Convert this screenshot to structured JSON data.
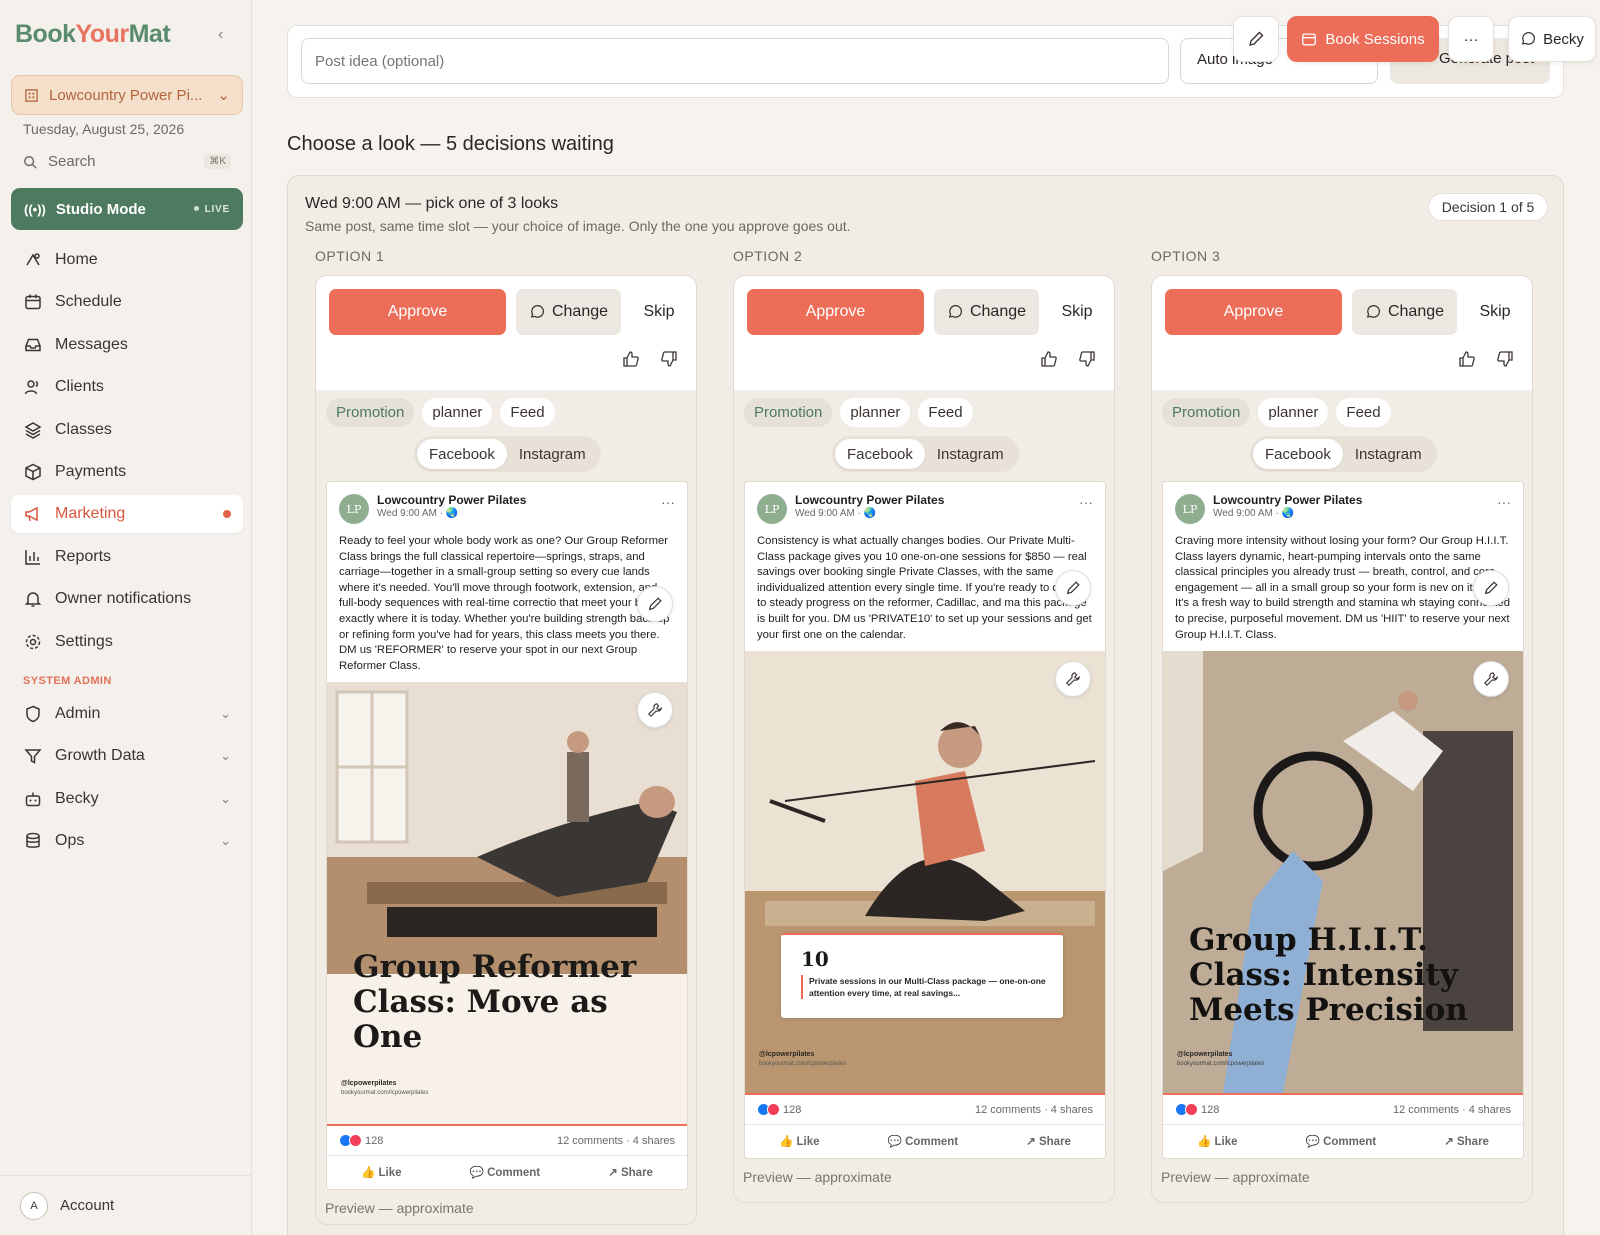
{
  "app": {
    "logo_part1": "Book",
    "logo_part2": "Your",
    "logo_part3": "Mat",
    "studio_name": "Lowcountry Power Pi...",
    "date": "Tuesday, August 25, 2026",
    "search_label": "Search",
    "search_shortcut": "⌘K",
    "studio_mode_label": "Studio Mode",
    "studio_mode_badge": "LIVE"
  },
  "nav": {
    "items": [
      {
        "label": "Home",
        "icon": "home-icon"
      },
      {
        "label": "Schedule",
        "icon": "calendar-icon"
      },
      {
        "label": "Messages",
        "icon": "inbox-icon"
      },
      {
        "label": "Clients",
        "icon": "users-icon"
      },
      {
        "label": "Classes",
        "icon": "layers-icon"
      },
      {
        "label": "Payments",
        "icon": "package-icon"
      },
      {
        "label": "Marketing",
        "icon": "megaphone-icon",
        "active": true
      },
      {
        "label": "Reports",
        "icon": "bar-chart-icon"
      },
      {
        "label": "Owner notifications",
        "icon": "bell-icon"
      },
      {
        "label": "Settings",
        "icon": "gear-icon"
      }
    ],
    "system_admin_heading": "SYSTEM ADMIN",
    "admin_items": [
      {
        "label": "Admin",
        "icon": "shield-icon"
      },
      {
        "label": "Growth Data",
        "icon": "filter-icon"
      },
      {
        "label": "Becky",
        "icon": "bot-icon"
      },
      {
        "label": "Ops",
        "icon": "database-icon"
      }
    ],
    "account_avatar": "A",
    "account_label": "Account"
  },
  "topbar": {
    "post_idea_placeholder": "Post idea (optional)",
    "auto_image": "Auto image",
    "generate_post": "Generate post",
    "book_sessions": "Book Sessions",
    "more": "···",
    "becky": "Becky"
  },
  "main": {
    "section_title": "Choose a look — 5 decisions waiting",
    "decision_title": "Wed 9:00 AM — pick one of 3 looks",
    "decision_subtitle": "Same post, same time slot — your choice of image. Only the one you approve goes out.",
    "decision_badge": "Decision 1 of 5"
  },
  "option_common": {
    "approve": "Approve",
    "change": "Change",
    "skip": "Skip",
    "chip_promotion": "Promotion",
    "chip_planner": "planner",
    "chip_feed": "Feed",
    "platform_facebook": "Facebook",
    "platform_instagram": "Instagram",
    "fb_page_name": "Lowcountry Power Pilates",
    "fb_time": "Wed 9:00 AM · 🌏",
    "fb_avatar": "LP",
    "fb_reactions": "128",
    "fb_comments_shares": "12 comments · 4 shares",
    "fb_like": "👍 Like",
    "fb_comment": "💬 Comment",
    "fb_share": "↗ Share",
    "preview_note": "Preview — approximate",
    "handle": "@lcpowerpilates",
    "handle_url": "bookyourmat.com/lcpowerpilates"
  },
  "options": [
    {
      "label": "OPTION 1",
      "post_text": "Ready to feel your whole body work as one? Our Group Reformer Class brings the full classical repertoire—springs, straps, and carriage—together in a small-group setting so every cue lands where it's needed. You'll move through footwork, extension, and full-body sequences with real-time correctio that meet your body exactly where it is today. Whether you're building strength back up or refining form you've had for years, this class meets you there. DM us 'REFORMER' to reserve your spot in our next Group Reformer Class.",
      "image_headline": "Group Reformer Class: Move as One"
    },
    {
      "label": "OPTION 2",
      "post_text": "Consistency is what actually changes bodies. Our Private Multi-Class package gives you 10 one-on-one sessions for $850 — real savings over booking single Private Classes, with the same individualized attention every single time. If you're ready to commit to steady progress on the reformer, Cadillac, and ma this package is built for you. DM us 'PRIVATE10' to set up your sessions and get your first one on the calendar.",
      "image_stat": "10",
      "image_stat_caption": "Private sessions in our Multi-Class package — one-on-one attention every time, at real savings..."
    },
    {
      "label": "OPTION 3",
      "post_text": "Craving more intensity without losing your form? Our Group H.I.I.T. Class layers dynamic, heart-pumping intervals onto the same classical principles you already trust — breath, control, and core engagement — all in a small group so your form is nev on its own. It's a fresh way to build strength and stamina wh staying connected to precise, purposeful movement. DM us 'HIIT' to reserve your next Group H.I.I.T. Class.",
      "image_headline": "Group H.I.I.T. Class: Intensity Meets Precision"
    }
  ],
  "colors": {
    "accent": "#ec6d58",
    "brand_green": "#4e7a60",
    "background": "#f6f3ef"
  }
}
